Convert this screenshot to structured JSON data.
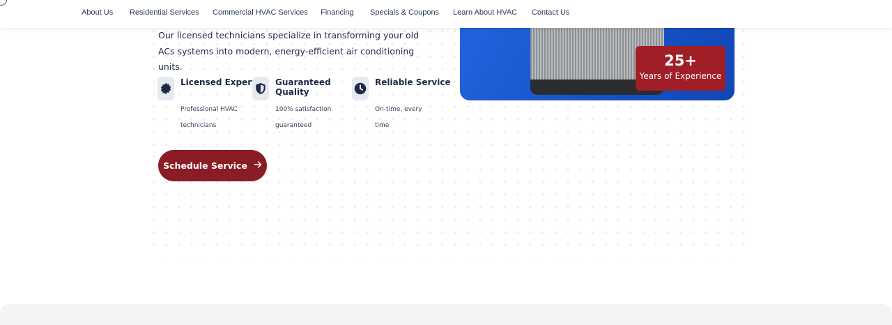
{
  "nav": {
    "items": [
      {
        "label": "About Us"
      },
      {
        "label": "Residential Services"
      },
      {
        "label": "Commercial HVAC Services"
      },
      {
        "label": "Financing"
      },
      {
        "label": "Specials & Coupons"
      },
      {
        "label": "Learn About HVAC"
      },
      {
        "label": "Contact Us"
      }
    ]
  },
  "intro": {
    "text": "Our licensed technicians specialize in transforming your old ACs systems into modern, energy-efficient air conditioning units."
  },
  "features": [
    {
      "icon": "badge-icon",
      "title": "Licensed Experts",
      "desc": "Professional HVAC technicians"
    },
    {
      "icon": "shield-icon",
      "title": "Guaranteed Quality",
      "desc": "100% satisfaction guaranteed"
    },
    {
      "icon": "clock-icon",
      "title": "Reliable Service",
      "desc": "On-time, every time"
    }
  ],
  "cta": {
    "label": "Schedule Service",
    "icon": "arrow-right-icon"
  },
  "badge": {
    "number": "25+",
    "label": "Years of Experience"
  },
  "colors": {
    "brand_red": "#8a1c25",
    "badge_red": "#a01e26",
    "hero_blue": "#1d5fd8",
    "navy_text": "#1f2a44",
    "icon_bg": "#e7e9f1"
  }
}
